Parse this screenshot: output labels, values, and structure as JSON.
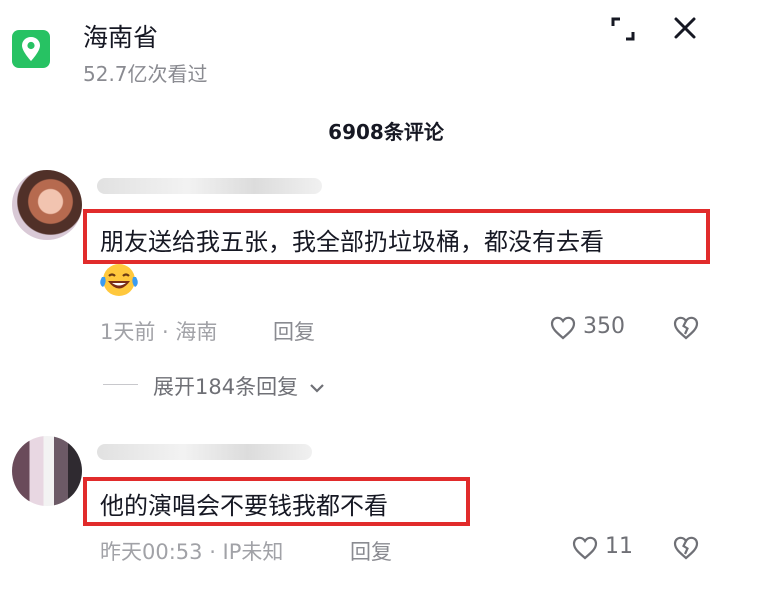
{
  "header": {
    "icon": "location-pin-icon",
    "title": "海南省",
    "views": "52.7亿次看过",
    "expand_icon": "expand-icon",
    "close_icon": "close-icon",
    "accent": "#27c263"
  },
  "comments_header": {
    "count_label": "6908条评论"
  },
  "comments": [
    {
      "text": "朋友送给我五张，我全部扔垃圾桶，都没有去看",
      "emoji": "laughing-crying-emoji",
      "time_location": "1天前 · 海南",
      "reply_label": "回复",
      "likes": "350",
      "replies_label": "展开184条回复"
    },
    {
      "text": "他的演唱会不要钱我都不看",
      "time_location": "昨天00:53 · IP未知",
      "reply_label": "回复",
      "likes": "11"
    }
  ],
  "colors": {
    "highlight_border": "#e12b2b",
    "meta_text": "#a1a2a7"
  }
}
